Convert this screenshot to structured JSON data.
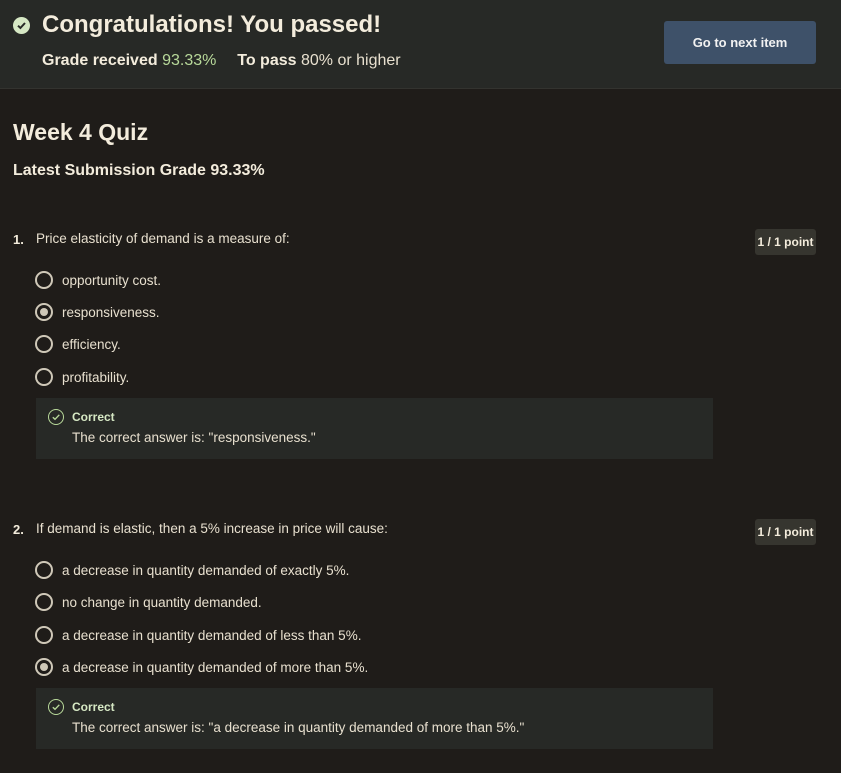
{
  "banner": {
    "title": "Congratulations! You passed!",
    "grade_label": "Grade received",
    "grade_value": "93.33%",
    "pass_label": "To pass",
    "pass_value": "80%",
    "pass_suffix": "or higher",
    "next_button": "Go to next item"
  },
  "quiz": {
    "title": "Week 4 Quiz",
    "latest_grade": "Latest Submission Grade 93.33%"
  },
  "questions": [
    {
      "number": "1.",
      "text": "Price elasticity of demand is a measure of:",
      "points": "1 / 1 point",
      "options": [
        {
          "label": "opportunity cost.",
          "selected": false
        },
        {
          "label": "responsiveness.",
          "selected": true
        },
        {
          "label": "efficiency.",
          "selected": false
        },
        {
          "label": "profitability.",
          "selected": false
        }
      ],
      "feedback": {
        "status": "Correct",
        "text": "The correct answer is: \"responsiveness.\""
      }
    },
    {
      "number": "2.",
      "text": "If demand is elastic, then a 5% increase in price will cause:",
      "points": "1 / 1 point",
      "options": [
        {
          "label": "a decrease in quantity demanded of exactly 5%.",
          "selected": false
        },
        {
          "label": "no change in quantity demanded.",
          "selected": false
        },
        {
          "label": "a decrease in quantity demanded of less than 5%.",
          "selected": false
        },
        {
          "label": "a decrease in quantity demanded of more than 5%.",
          "selected": true
        }
      ],
      "feedback": {
        "status": "Correct",
        "text": "The correct answer is: \"a decrease in quantity demanded of more than 5%.\""
      }
    }
  ],
  "colors": {
    "background": "#1f1c19",
    "banner": "#272926",
    "accent_green": "#b8d99a",
    "button": "#3e5169"
  }
}
